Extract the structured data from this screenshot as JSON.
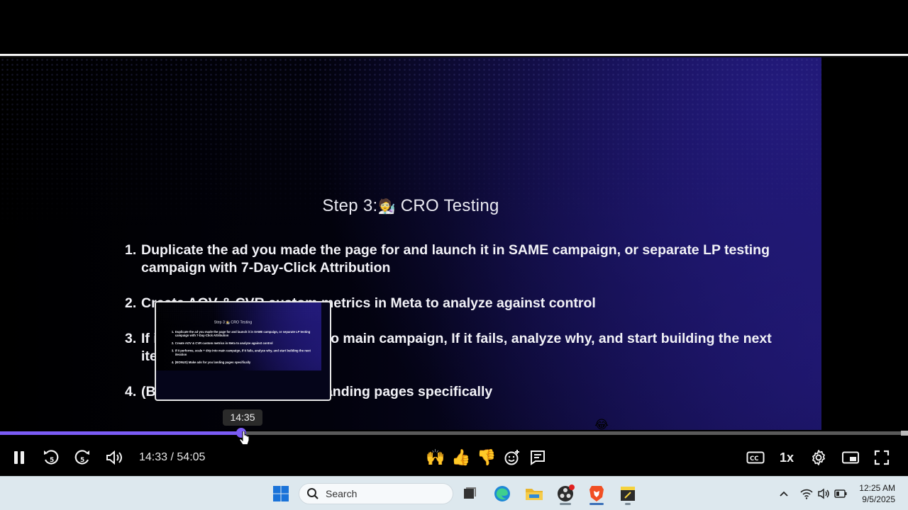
{
  "slide": {
    "title_prefix": "Step 3:",
    "title_emoji": "🧑‍🔬",
    "title_suffix": " CRO Testing",
    "items": [
      {
        "num": "1.",
        "text": "Duplicate the ad you made the page for and launch it in SAME campaign, or separate LP testing campaign with 7-Day-Click Attribution"
      },
      {
        "num": "2.",
        "text": "Create AOV & CVR custom metrics in Meta to analyze against control"
      },
      {
        "num": "3.",
        "text": "If it performs, scale + drip into main campaign, If it fails, analyze why, and start building the next iteration"
      },
      {
        "num": "4.",
        "text": "(BONUS) Make ads for you landing pages specifically"
      }
    ]
  },
  "preview": {
    "tooltip_time": "14:35"
  },
  "progress": {
    "played_fraction": 0.268,
    "hover_fraction": 0.268,
    "reaction_markers": [
      {
        "emoji": "😍",
        "fraction": 0.008
      },
      {
        "emoji": "😂",
        "fraction": 0.667
      }
    ]
  },
  "player": {
    "current_time": "14:33",
    "separator": " / ",
    "duration": "54:05",
    "speed": "1x",
    "reactions": [
      "😂",
      "😍",
      "😮",
      "🙌",
      "👍",
      "👎"
    ],
    "colors": {
      "accent": "#7b5cf5"
    }
  },
  "taskbar": {
    "search_label": "Search",
    "time": "12:25 AM",
    "date": "9/5/2025"
  }
}
